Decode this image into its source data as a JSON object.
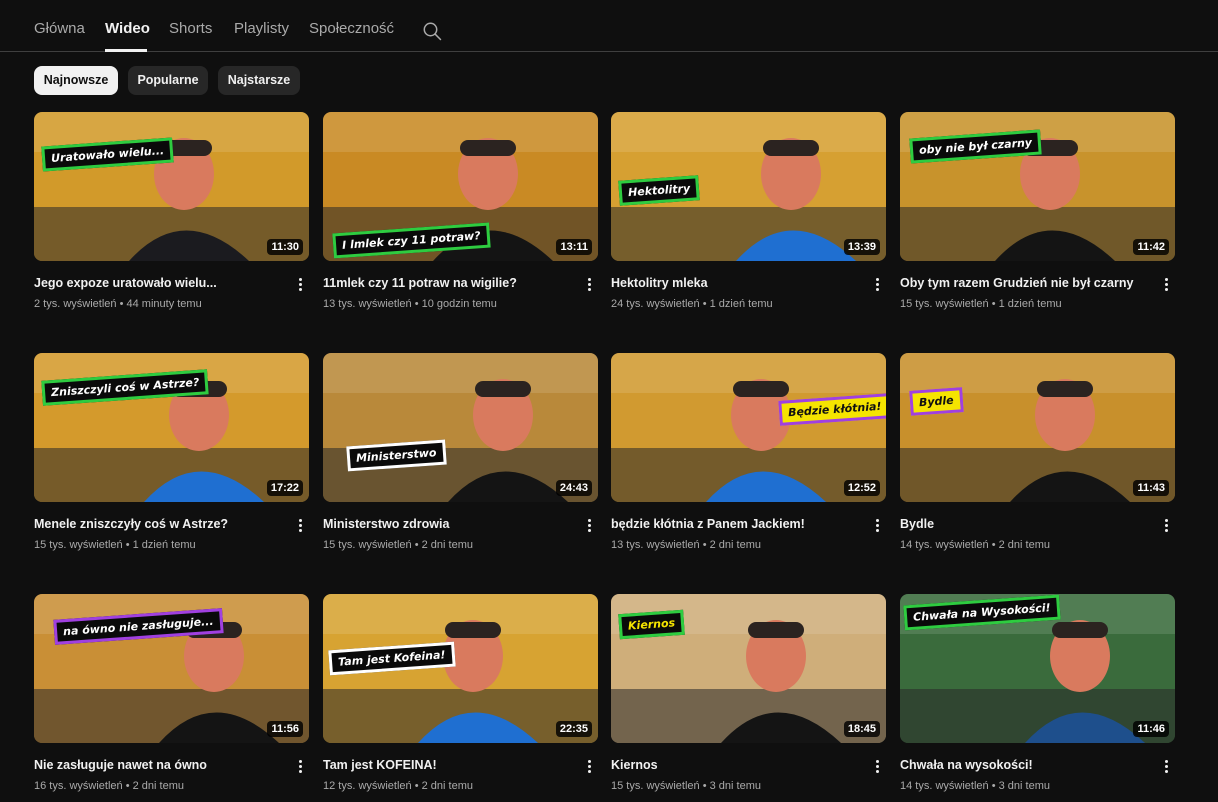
{
  "tabs": [
    {
      "label": "Główna",
      "active": false
    },
    {
      "label": "Wideo",
      "active": true
    },
    {
      "label": "Shorts",
      "active": false
    },
    {
      "label": "Playlisty",
      "active": false
    },
    {
      "label": "Społeczność",
      "active": false
    }
  ],
  "search_icon": "search-icon",
  "chips": [
    {
      "label": "Najnowsze",
      "active": true
    },
    {
      "label": "Popularne",
      "active": false
    },
    {
      "label": "Najstarsze",
      "active": false
    }
  ],
  "videos": [
    {
      "title": "Jego expoze uratowało wielu...",
      "views": "2 tys. wyświetleń",
      "age": "44 minuty temu",
      "duration": "11:30",
      "overlay": "Uratowało wielu...",
      "overlay_bg": "#0a0a0a",
      "overlay_border": "#2ecc40",
      "overlay_color": "#ffffff",
      "bg": "#d29a2a",
      "shirt": "#1b1b1f"
    },
    {
      "title": "11mlek czy 11 potraw na wigilie?",
      "views": "13 tys. wyświetleń",
      "age": "10 godzin temu",
      "duration": "13:11",
      "overlay": "I lmlek czy 11 potraw?",
      "overlay_bg": "#0a0a0a",
      "overlay_border": "#2ecc40",
      "overlay_color": "#ffffff",
      "bg": "#c98a24",
      "shirt": "#141414"
    },
    {
      "title": "Hektolitry mleka",
      "views": "24 tys. wyświetleń",
      "age": "1 dzień temu",
      "duration": "13:39",
      "overlay": "Hektolitry",
      "overlay_bg": "#0a0a0a",
      "overlay_border": "#2ecc40",
      "overlay_color": "#ffffff",
      "bg": "#d6a032",
      "shirt": "#1f6fd1"
    },
    {
      "title": "Oby tym razem Grudzień nie był czarny",
      "views": "15 tys. wyświetleń",
      "age": "1 dzień temu",
      "duration": "11:42",
      "overlay": "oby nie był czarny",
      "overlay_bg": "#0a0a0a",
      "overlay_border": "#2ecc40",
      "overlay_color": "#ffffff",
      "bg": "#c8932c",
      "shirt": "#141414"
    },
    {
      "title": "Menele zniszczyły coś w Astrze?",
      "views": "15 tys. wyświetleń",
      "age": "1 dzień temu",
      "duration": "17:22",
      "overlay": "Zniszczyli coś w Astrze?",
      "overlay_bg": "#0a0a0a",
      "overlay_border": "#2ecc40",
      "overlay_color": "#ffffff",
      "bg": "#d49a2c",
      "shirt": "#1f6fd1"
    },
    {
      "title": "Ministerstwo zdrowia",
      "views": "15 tys. wyświetleń",
      "age": "2 dni temu",
      "duration": "24:43",
      "overlay": "Ministerstwo",
      "overlay_bg": "#0a0a0a",
      "overlay_border": "#ffffff",
      "overlay_color": "#ffffff",
      "bg": "#b9893a",
      "shirt": "#141414"
    },
    {
      "title": "będzie kłótnia z Panem Jackiem!",
      "views": "13 tys. wyświetleń",
      "age": "2 dni temu",
      "duration": "12:52",
      "overlay": "Będzie kłótnia!",
      "overlay_bg": "#f5e400",
      "overlay_border": "#a040e0",
      "overlay_color": "#111111",
      "bg": "#d19a30",
      "shirt": "#1f6fd1"
    },
    {
      "title": "Bydle",
      "views": "14 tys. wyświetleń",
      "age": "2 dni temu",
      "duration": "11:43",
      "overlay": "Bydle",
      "overlay_bg": "#f5e400",
      "overlay_border": "#a040e0",
      "overlay_color": "#111111",
      "bg": "#c8902c",
      "shirt": "#141414"
    },
    {
      "title": "Nie zasługuje nawet na ówno",
      "views": "16 tys. wyświetleń",
      "age": "2 dni temu",
      "duration": "11:56",
      "overlay": "na ówno nie zasługuje...",
      "overlay_bg": "#0a0a0a",
      "overlay_border": "#a040e0",
      "overlay_color": "#ffffff",
      "bg": "#c98f36",
      "shirt": "#141414"
    },
    {
      "title": "Tam jest KOFEINA!",
      "views": "12 tys. wyświetleń",
      "age": "2 dni temu",
      "duration": "22:35",
      "overlay": "Tam jest Kofeina!",
      "overlay_bg": "#0a0a0a",
      "overlay_border": "#ffffff",
      "overlay_color": "#ffffff",
      "bg": "#d7a332",
      "shirt": "#1f6fd1"
    },
    {
      "title": "Kiernos",
      "views": "15 tys. wyświetleń",
      "age": "3 dni temu",
      "duration": "18:45",
      "overlay": "Kiernos",
      "overlay_bg": "#0a0a0a",
      "overlay_border": "#2ecc40",
      "overlay_color": "#f5e400",
      "bg": "#cfae7a",
      "shirt": "#141414"
    },
    {
      "title": "Chwała na wysokości!",
      "views": "14 tys. wyświetleń",
      "age": "3 dni temu",
      "duration": "11:46",
      "overlay": "Chwała na Wysokości!",
      "overlay_bg": "#0a0a0a",
      "overlay_border": "#2ecc40",
      "overlay_color": "#ffffff",
      "bg": "#3a6b3c",
      "shirt": "#1e4f8c"
    }
  ]
}
